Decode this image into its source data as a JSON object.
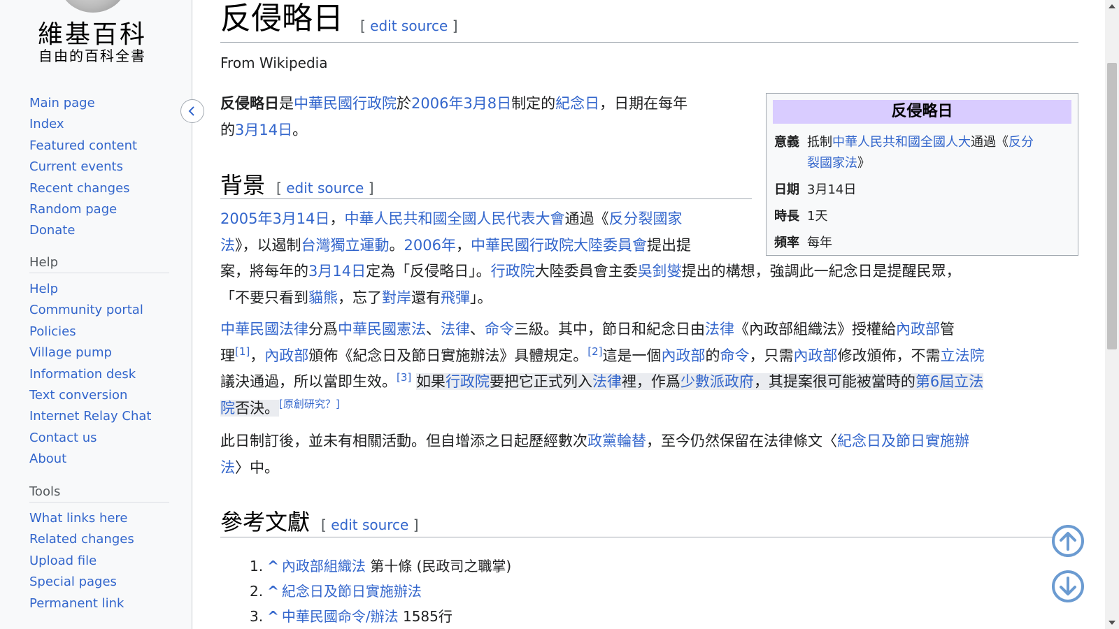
{
  "logo": {
    "line1": "維基百科",
    "line2": "自由的百科全書"
  },
  "sidebar": {
    "main": [
      "Main page",
      "Index",
      "Featured content",
      "Current events",
      "Recent changes",
      "Random page",
      "Donate"
    ],
    "help_heading": "Help",
    "help": [
      "Help",
      "Community portal",
      "Policies",
      "Village pump",
      "Information desk",
      "Text conversion",
      "Internet Relay Chat",
      "Contact us",
      "About"
    ],
    "tools_heading": "Tools",
    "tools": [
      "What links here",
      "Related changes",
      "Upload file",
      "Special pages",
      "Permanent link"
    ]
  },
  "article": {
    "title": "反侵略日",
    "edit_open": "[ ",
    "edit_label": "edit source",
    "edit_close": " ]",
    "from": "From Wikipedia",
    "intro": [
      {
        "b": "反侵略日"
      },
      {
        "t": "是"
      },
      {
        "l": "中華民國行政院"
      },
      {
        "t": "於"
      },
      {
        "l": "2006年3月8日"
      },
      {
        "t": "制定的"
      },
      {
        "l": "紀念日"
      },
      {
        "t": "，日期在每年"
      },
      {
        "br": ""
      },
      {
        "t": "的"
      },
      {
        "l": "3月14日"
      },
      {
        "t": "。"
      }
    ],
    "sec1": "背景",
    "p1_line1": [
      {
        "l": "2005年3月14日"
      },
      {
        "t": "，"
      },
      {
        "l": "中華人民共和國全國人民代表大會"
      },
      {
        "t": "通過《"
      },
      {
        "l": "反分裂國家"
      }
    ],
    "p1_line2": [
      {
        "l": "法"
      },
      {
        "t": "》，以遏制"
      },
      {
        "l": "台灣獨立運動"
      },
      {
        "t": "。"
      },
      {
        "l": "2006年"
      },
      {
        "t": "，"
      },
      {
        "l": "中華民國行政院大陸委員會"
      },
      {
        "t": "提出提"
      }
    ],
    "p1_line3": [
      {
        "t": "案，將每年的"
      },
      {
        "l": "3月14日"
      },
      {
        "t": "定為「反侵略日」。"
      },
      {
        "l": "行政院"
      },
      {
        "t": "大陸委員會主委"
      },
      {
        "l": "吳釗燮"
      },
      {
        "t": "提出的構想，強調此一紀念日是提醒民眾，"
      }
    ],
    "p1_line4": [
      {
        "t": "「不要只看到"
      },
      {
        "l": "貓熊"
      },
      {
        "t": "，忘了"
      },
      {
        "l": "對岸"
      },
      {
        "t": "還有"
      },
      {
        "l": "飛彈"
      },
      {
        "t": "」。"
      }
    ],
    "p2_line1": [
      {
        "l": "中華民國法律"
      },
      {
        "t": "分爲"
      },
      {
        "l": "中華民國憲法"
      },
      {
        "t": "、"
      },
      {
        "l": "法律"
      },
      {
        "t": "、"
      },
      {
        "l": "命令"
      },
      {
        "t": "三級。其中，節日和紀念日由"
      },
      {
        "l": "法律"
      },
      {
        "t": "《內政部組織法》授權給"
      },
      {
        "l": "內政部"
      },
      {
        "t": "管"
      }
    ],
    "p2_line2": [
      {
        "t": "理"
      },
      {
        "s": "[1]"
      },
      {
        "t": "，"
      },
      {
        "l": "內政部"
      },
      {
        "t": "頒佈《紀念日及節日實施辦法》具體規定。"
      },
      {
        "s": "[2]"
      },
      {
        "t": "這是一個"
      },
      {
        "l": "內政部"
      },
      {
        "t": "的"
      },
      {
        "l": "命令"
      },
      {
        "t": "，只需"
      },
      {
        "l": "內政部"
      },
      {
        "t": "修改頒佈，不需"
      },
      {
        "l": "立法院"
      }
    ],
    "p2_line3a": [
      {
        "t": "議決通過，所以當即生效。"
      },
      {
        "s": "[3]"
      },
      {
        "t": " "
      }
    ],
    "p2_line3b": [
      {
        "t": "如果"
      },
      {
        "l": "行政院"
      },
      {
        "t": "要把它正式列入"
      },
      {
        "l": "法律"
      },
      {
        "t": "裡，作爲"
      },
      {
        "l": "少數派政府"
      },
      {
        "t": "，其提案很可能被當時的"
      },
      {
        "l": "第6屆立法"
      }
    ],
    "p2_line4a": [
      {
        "l": "院"
      },
      {
        "t": "否決。"
      }
    ],
    "p2_line4b": [
      {
        "s": "[原創研究？]"
      }
    ],
    "p3_line1": [
      {
        "t": "此日制訂後，並未有相關活動。但自增添之日起歷經數次"
      },
      {
        "l": "政黨輪替"
      },
      {
        "t": "，至今仍然保留在法律條文〈"
      },
      {
        "l": "紀念日及節日實施辦"
      }
    ],
    "p3_line2": [
      {
        "l": "法"
      },
      {
        "t": "〉中。"
      }
    ],
    "sec2": "參考文獻",
    "refs": [
      {
        "num": "1.",
        "caret": "^",
        "link": "內政部組織法",
        "text": " 第十條 (民政司之職掌)"
      },
      {
        "num": "2.",
        "caret": "^",
        "link": "紀念日及節日實施辦法",
        "text": ""
      },
      {
        "num": "3.",
        "caret": "^",
        "link": "中華民國命令/辦法",
        "text": " 1585行"
      }
    ]
  },
  "infobox": {
    "title": "反侵略日",
    "rows": [
      {
        "k": "意義",
        "v": [
          {
            "t": "抵制"
          },
          {
            "l": "中華人民共和國全國人大"
          },
          {
            "t": "通過《"
          },
          {
            "l": "反分"
          },
          {
            "br": ""
          },
          {
            "l": "裂國家法"
          },
          {
            "t": "》"
          }
        ]
      },
      {
        "k": "日期",
        "v": [
          {
            "t": "3月14日"
          }
        ]
      },
      {
        "k": "時長",
        "v": [
          {
            "t": "1天"
          }
        ]
      },
      {
        "k": "頻率",
        "v": [
          {
            "t": "每年"
          }
        ]
      }
    ]
  },
  "colors": {
    "link": "#3366cc",
    "infobox_title_bg": "#d9ccff",
    "scroll_btn": "#6b9bd1"
  },
  "icons": {
    "collapse": "chevron-left-icon",
    "scroll_up": "arrow-up-circle-icon",
    "scroll_down": "arrow-down-circle-icon"
  }
}
